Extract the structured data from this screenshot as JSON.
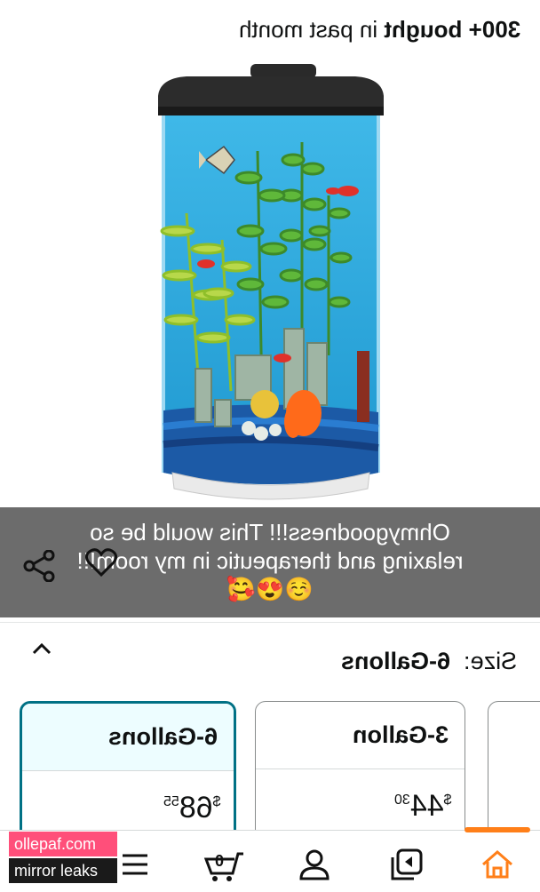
{
  "header": {
    "bought_bold": "300+ bought",
    "bought_rest": " in past month"
  },
  "caption": {
    "line1": "Ohmygoodness!!! This would be so",
    "line2": "relaxing and therapeutic in my room!!!",
    "emojis": "☺️😍🥰"
  },
  "size": {
    "label": "Size:",
    "selected": "6-Gallons"
  },
  "options": [
    {
      "name": "6-Gallons",
      "price_symbol": "$",
      "price_whole": "68",
      "price_cents": "55",
      "selected": true
    },
    {
      "name": "3-Gallon",
      "price_symbol": "$",
      "price_whole": "44",
      "price_cents": "30",
      "selected": false
    }
  ],
  "nav": {
    "items": [
      "menu-icon",
      "cart-icon",
      "account-icon",
      "library-icon",
      "home-icon"
    ],
    "cart_count": "0",
    "active_color": "#ff7f19"
  },
  "watermark": {
    "top": "ollepaf.com",
    "bottom": "mirror leaks"
  },
  "colors": {
    "selected_border": "#007185",
    "selected_fill": "#edfdff",
    "caption_bg": "#606060"
  }
}
